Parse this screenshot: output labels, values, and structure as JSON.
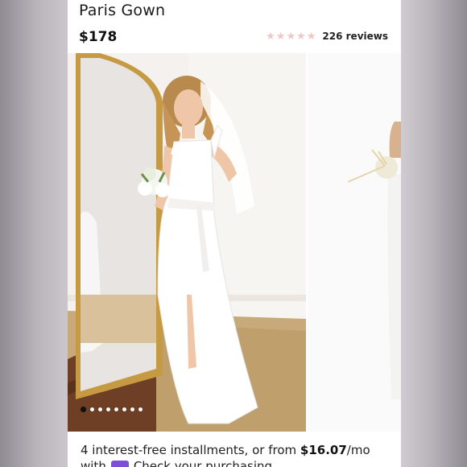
{
  "product": {
    "title": "Paris Gown",
    "price": "$178",
    "rating_value": 4.5,
    "rating_max": 5,
    "reviews": "226 reviews"
  },
  "icons": {
    "star": "star-icon",
    "star_color": "#f0c6c6"
  },
  "gallery": {
    "slide_count": 8,
    "active_index": 0
  },
  "installments": {
    "prefix": "4 interest-free installments, or from ",
    "amount": "$16.07",
    "suffix": "/mo",
    "line2_start": "with",
    "line2_rest": "Check your purchasing"
  },
  "colors": {
    "badge": "#7b4fd8",
    "active_dot": "#111111"
  }
}
